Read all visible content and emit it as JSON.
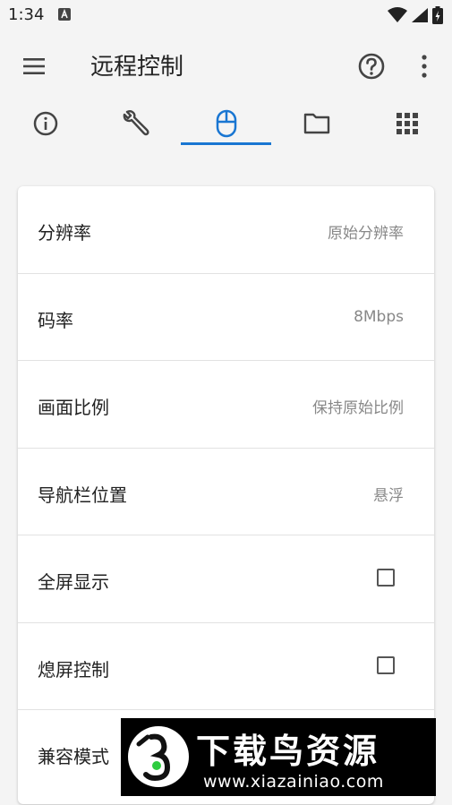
{
  "status_bar": {
    "time": "1:34"
  },
  "app_bar": {
    "title": "远程控制"
  },
  "tabs": [
    {
      "name": "info",
      "icon": "info-icon",
      "selected": false
    },
    {
      "name": "tools",
      "icon": "wrench-icon",
      "selected": false
    },
    {
      "name": "mouse",
      "icon": "mouse-icon",
      "selected": true
    },
    {
      "name": "folder",
      "icon": "folder-icon",
      "selected": false
    },
    {
      "name": "apps",
      "icon": "grid-icon",
      "selected": false
    }
  ],
  "settings": {
    "resolution": {
      "label": "分辨率",
      "value": "原始分辨率"
    },
    "bitrate": {
      "label": "码率",
      "value": "8Mbps"
    },
    "aspect_ratio": {
      "label": "画面比例",
      "value": "保持原始比例"
    },
    "navbar_position": {
      "label": "导航栏位置",
      "value": "悬浮"
    },
    "fullscreen": {
      "label": "全屏显示",
      "checked": false
    },
    "screen_off_control": {
      "label": "熄屏控制",
      "checked": false
    },
    "compat_mode": {
      "label": "兼容模式"
    }
  },
  "watermark": {
    "title": "下载鸟资源",
    "url": "www.xiazainiao.com"
  },
  "colors": {
    "accent": "#1976d2",
    "background": "#f4f4f4",
    "card": "#ffffff"
  }
}
